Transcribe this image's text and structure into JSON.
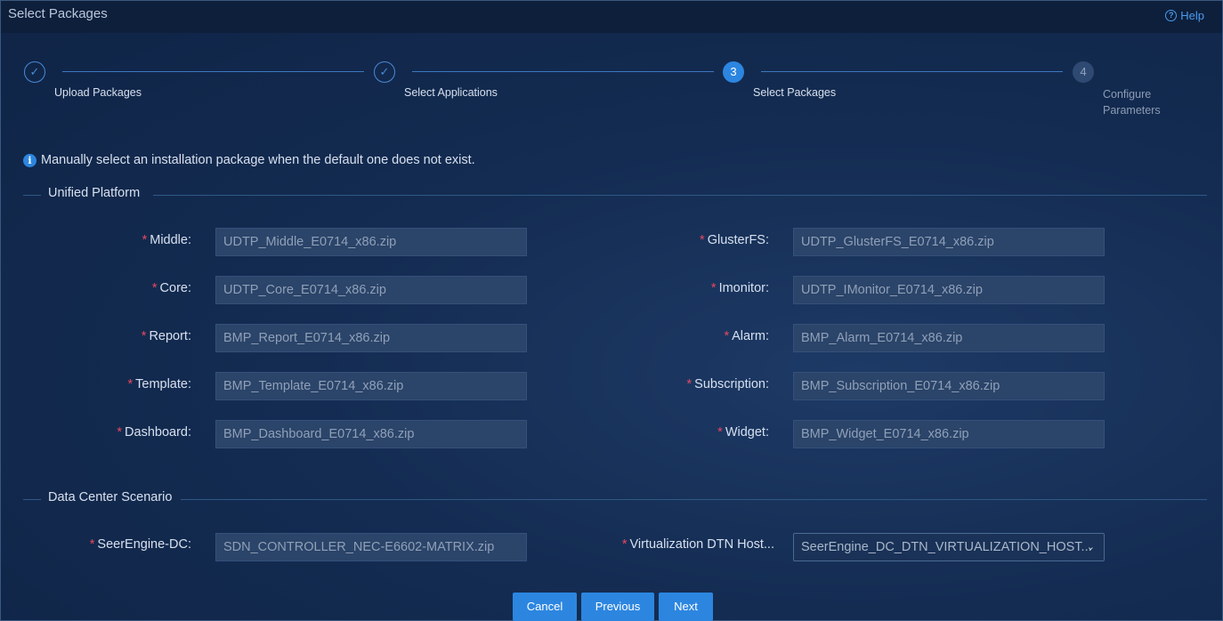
{
  "window": {
    "title": "Select Packages",
    "help_label": "Help"
  },
  "steps": [
    {
      "label": "Upload Packages",
      "state": "done"
    },
    {
      "label": "Select Applications",
      "state": "done"
    },
    {
      "number": "3",
      "label": "Select Packages",
      "state": "active"
    },
    {
      "number": "4",
      "label": "Configure Parameters",
      "label_lines": [
        "Configure",
        "Parameters"
      ],
      "state": "pending"
    }
  ],
  "info_text": "Manually select an installation package when the default one does not exist.",
  "sections": {
    "unified": {
      "title": "Unified Platform",
      "fields": [
        {
          "label": "Middle",
          "value": "UDTP_Middle_E0714_x86.zip"
        },
        {
          "label": "GlusterFS",
          "value": "UDTP_GlusterFS_E0714_x86.zip"
        },
        {
          "label": "Core",
          "value": "UDTP_Core_E0714_x86.zip"
        },
        {
          "label": "Imonitor",
          "value": "UDTP_IMonitor_E0714_x86.zip"
        },
        {
          "label": "Report",
          "value": "BMP_Report_E0714_x86.zip"
        },
        {
          "label": "Alarm",
          "value": "BMP_Alarm_E0714_x86.zip"
        },
        {
          "label": "Template",
          "value": "BMP_Template_E0714_x86.zip"
        },
        {
          "label": "Subscription",
          "value": "BMP_Subscription_E0714_x86.zip"
        },
        {
          "label": "Dashboard",
          "value": "BMP_Dashboard_E0714_x86.zip"
        },
        {
          "label": "Widget",
          "value": "BMP_Widget_E0714_x86.zip"
        }
      ]
    },
    "datacenter": {
      "title": "Data Center Scenario",
      "fields": [
        {
          "label": "SeerEngine-DC",
          "value": "SDN_CONTROLLER_NEC-E6602-MATRIX.zip"
        },
        {
          "label": "Virtualization DTN Host...",
          "value": "SeerEngine_DC_DTN_VIRTUALIZATION_HOST..."
        }
      ]
    }
  },
  "buttons": {
    "cancel": "Cancel",
    "previous": "Previous",
    "next": "Next"
  },
  "colors": {
    "accent": "#2c86e0",
    "required": "#e8485f",
    "background": "#142c52"
  },
  "icons": {
    "help": "question-circle-icon",
    "info": "info-circle-icon",
    "step_done": "check-icon",
    "select": "chevron-down-icon"
  }
}
